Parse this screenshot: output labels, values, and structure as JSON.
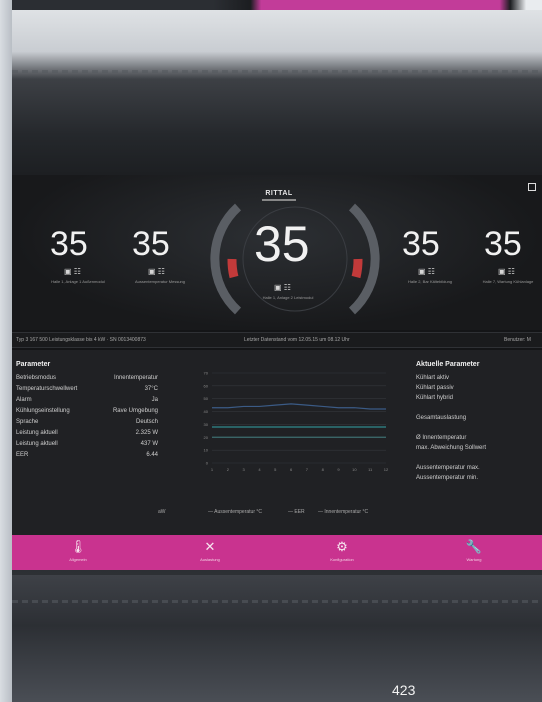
{
  "header": {
    "brand": "RITTAL",
    "page_number": "423"
  },
  "hud": {
    "left_outer": {
      "value": "35",
      "caption": "Halle 1, Anlage 1 Außenmodul"
    },
    "left_inner": {
      "value": "35",
      "caption": "Aussentemperatur Messung"
    },
    "center": {
      "value": "35",
      "caption": "Halle 1, Anlage 2 Leistmodul"
    },
    "right_inner": {
      "value": "35",
      "caption": "Halle 2, Bar Kältebildung"
    },
    "right_outer": {
      "value": "35",
      "caption": "Halle 7, Wartung Kühlanlage"
    }
  },
  "status": {
    "left": "Typ 3 167 500 Leistungsklasse bis 4 kW · SN 0013400873",
    "middle": "Letzter Datenstand vom 12.05.15 um 08.12 Uhr",
    "right": "Benutzer: M"
  },
  "parameters": {
    "title": "Parameter",
    "rows": [
      {
        "label": "Betriebsmodus",
        "value": "Innentemperatur"
      },
      {
        "label": "Temperaturschwellwert",
        "value": "37°C"
      },
      {
        "label": "Alarm",
        "value": "Ja"
      },
      {
        "label": "Kühlungseinstellung",
        "value": "Rave Umgebung"
      },
      {
        "label": "Sprache",
        "value": "Deutsch"
      },
      {
        "label": "Leistung aktuell",
        "value": "2.325 W"
      },
      {
        "label": "Leistung aktuell",
        "value": "437 W"
      },
      {
        "label": "EER",
        "value": "6.44"
      }
    ]
  },
  "aktuelle": {
    "title": "Aktuelle Parameter",
    "rows": [
      "Kühlart aktiv",
      "Kühlart passiv",
      "Kühlart hybrid",
      "",
      "Gesamtauslastung",
      "",
      "Ø Innentemperatur",
      "max. Abweichung Sollwert",
      "",
      "Aussentemperatur max.",
      "Aussentemperatur min."
    ]
  },
  "chart_data": {
    "type": "line",
    "x": [
      1,
      2,
      3,
      4,
      5,
      6,
      7,
      8,
      9,
      10,
      11,
      12
    ],
    "ylim": [
      0,
      70
    ],
    "yticks": [
      "70",
      "60",
      "50",
      "40",
      "30",
      "20",
      "10",
      "0"
    ],
    "series": [
      {
        "name": "Aussentemperatur °C",
        "values": [
          43,
          43,
          44,
          44,
          45,
          46,
          45,
          44,
          43,
          43,
          42,
          42
        ]
      },
      {
        "name": "EER",
        "values": [
          28,
          28,
          28,
          28,
          28,
          28,
          28,
          28,
          28,
          28,
          28,
          28
        ]
      },
      {
        "name": "Innentemperatur °C",
        "values": [
          20,
          20,
          20,
          20,
          20,
          20,
          20,
          20,
          20,
          20,
          20,
          20
        ]
      }
    ],
    "xlabel": "",
    "ylabel": "",
    "colors": [
      "#3b5b86",
      "#2f8a8c",
      "#3d6e6f"
    ]
  },
  "legend": {
    "unit_label": "aW",
    "series1": "Aussentemperatur °C",
    "series2": "EER",
    "series3": "Innentemperatur °C"
  },
  "nav": [
    {
      "label": "Allgemein",
      "icon": "thermometer-icon"
    },
    {
      "label": "Auslastung",
      "icon": "expand-icon"
    },
    {
      "label": "Konfiguration",
      "icon": "gear-icon"
    },
    {
      "label": "Wartung",
      "icon": "wrench-icon"
    }
  ]
}
